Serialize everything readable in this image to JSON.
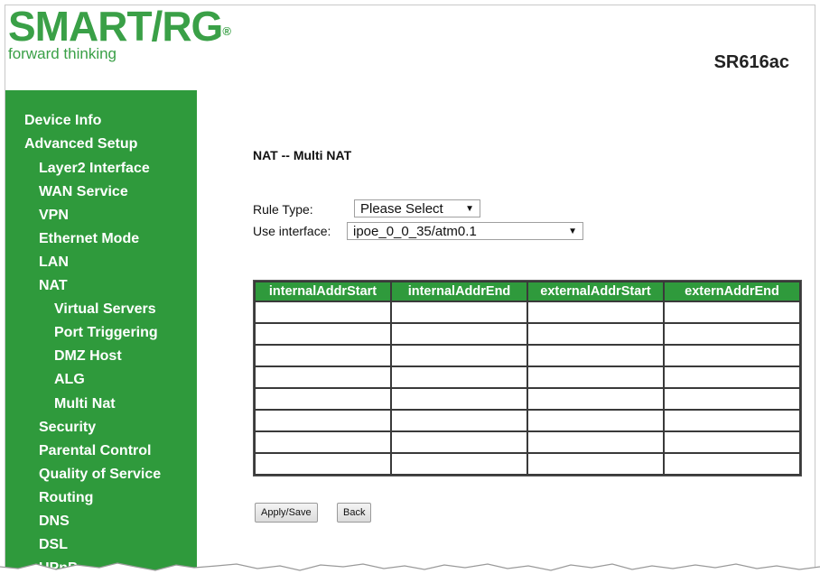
{
  "header": {
    "logo_text": "SMART/RG",
    "logo_reg": "®",
    "tagline": "forward thinking",
    "model": "SR616ac"
  },
  "sidebar": {
    "items": [
      {
        "label": "Device Info"
      },
      {
        "label": "Advanced Setup"
      },
      {
        "label": "Layer2 Interface"
      },
      {
        "label": "WAN Service"
      },
      {
        "label": "VPN"
      },
      {
        "label": "Ethernet Mode"
      },
      {
        "label": "LAN"
      },
      {
        "label": "NAT"
      },
      {
        "label": "Virtual Servers"
      },
      {
        "label": "Port Triggering"
      },
      {
        "label": "DMZ Host"
      },
      {
        "label": "ALG"
      },
      {
        "label": "Multi Nat"
      },
      {
        "label": "Security"
      },
      {
        "label": "Parental Control"
      },
      {
        "label": "Quality of Service"
      },
      {
        "label": "Routing"
      },
      {
        "label": "DNS"
      },
      {
        "label": "DSL"
      },
      {
        "label": "UPnP"
      }
    ]
  },
  "main": {
    "title": "NAT -- Multi NAT",
    "rule_type_label": "Rule Type:",
    "rule_type_value": "Please Select",
    "use_interface_label": "Use interface:",
    "use_interface_value": "ipoe_0_0_35/atm0.1",
    "table": {
      "columns": [
        "internalAddrStart",
        "internalAddrEnd",
        "externalAddrStart",
        "externAddrEnd"
      ],
      "row_count": 8
    },
    "apply_button": "Apply/Save",
    "back_button": "Back"
  }
}
